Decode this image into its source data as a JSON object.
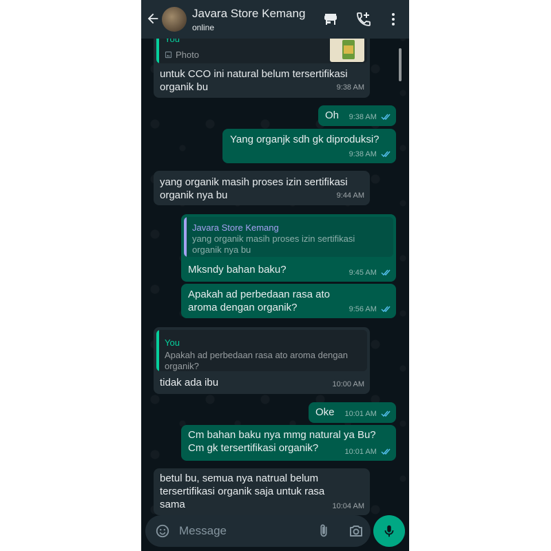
{
  "header": {
    "contact_name": "Javara Store Kemang",
    "status": "online"
  },
  "messages": [
    {
      "direction": "incoming",
      "quote": {
        "author": "You",
        "text": "Photo",
        "has_thumbnail": true
      },
      "text": "untuk CCO ini natural belum tersertifikasi organik bu",
      "time": "9:38 AM"
    },
    {
      "direction": "outgoing",
      "text": "Oh",
      "time": "9:38 AM",
      "read": true
    },
    {
      "direction": "outgoing",
      "text": "Yang organjk sdh gk diproduksi?",
      "time": "9:38 AM",
      "read": true
    },
    {
      "direction": "incoming",
      "text": "yang organik masih proses izin sertifikasi organik nya bu",
      "time": "9:44 AM"
    },
    {
      "direction": "outgoing",
      "quote": {
        "author": "Javara Store Kemang",
        "text": "yang organik masih proses izin sertifikasi organik nya bu"
      },
      "text": "Mksndy bahan baku?",
      "time": "9:45 AM",
      "read": true
    },
    {
      "direction": "outgoing",
      "text": "Apakah ad perbedaan rasa ato aroma dengan organik?",
      "time": "9:56 AM",
      "read": true
    },
    {
      "direction": "incoming",
      "quote": {
        "author": "You",
        "text": "Apakah ad perbedaan rasa ato aroma dengan organik?"
      },
      "text": "tidak ada ibu",
      "time": "10:00 AM"
    },
    {
      "direction": "outgoing",
      "text": "Oke",
      "time": "10:01 AM",
      "read": true
    },
    {
      "direction": "outgoing",
      "text": "Cm bahan baku nya mmg natural ya Bu? Cm gk tersertifikasi organik?",
      "time": "10:01 AM",
      "read": true
    },
    {
      "direction": "incoming",
      "text": "betul bu, semua nya natrual belum tersertifikasi organik saja untuk rasa sama",
      "time": "10:04 AM"
    }
  ],
  "composer": {
    "placeholder": "Message"
  },
  "colors": {
    "background": "#0b141a",
    "header": "#1f2c34",
    "incoming_bubble": "#202c33",
    "outgoing_bubble": "#005c4b",
    "accent_green": "#00a884",
    "read_ticks": "#53bdeb",
    "quote_bar_contact": "#a5a1f2",
    "quote_bar_self": "#06cf9c"
  },
  "icons": [
    "back-arrow-icon",
    "store-icon",
    "add-call-icon",
    "more-vert-icon",
    "emoji-icon",
    "attach-icon",
    "camera-icon",
    "mic-icon",
    "photo-icon",
    "double-check-icon"
  ]
}
